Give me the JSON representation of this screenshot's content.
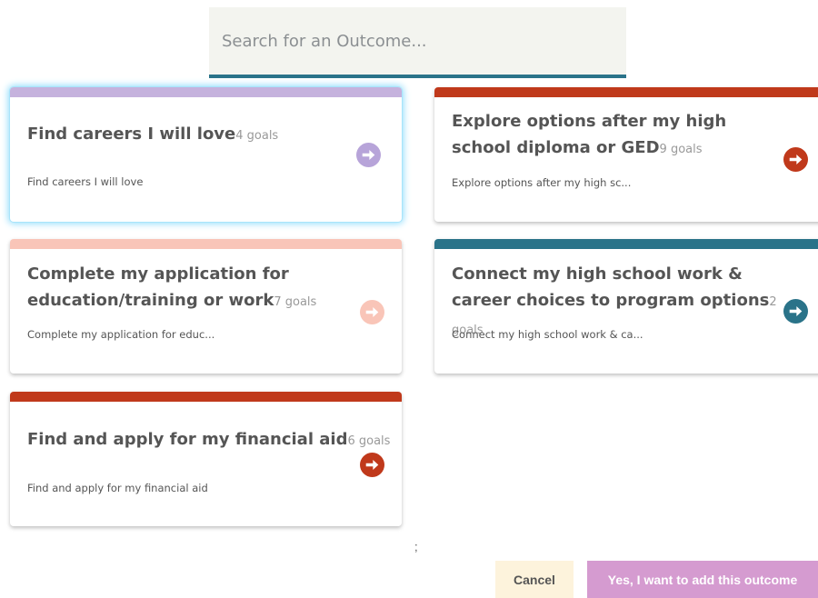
{
  "search": {
    "placeholder": "Search for an Outcome..."
  },
  "outcomes": [
    {
      "title": "Find careers I will love",
      "goals": "4 goals",
      "description": "Find careers I will love",
      "bar_color": "#c5b2dd",
      "arrow_color": "#b7a4d9",
      "selected": true,
      "arrow_icon": "arrow-right-circle-icon"
    },
    {
      "title": "Explore options after my high school diploma or GED",
      "goals": "9 goals",
      "description": "Explore options after my high sc...",
      "bar_color": "#c0391b",
      "arrow_color": "#c0391b",
      "selected": false,
      "arrow_icon": "arrow-right-circle-icon"
    },
    {
      "title": "Complete my application for education/training or work",
      "goals": "7 goals",
      "description": "Complete my application for educ...",
      "bar_color": "#f9c5b8",
      "arrow_color": "#f9c5b8",
      "selected": false,
      "arrow_icon": "arrow-right-circle-icon"
    },
    {
      "title": "Connect my high school work & career choices to program options",
      "goals": "2 goals",
      "description": "Connect my high school work & ca...",
      "bar_color": "#2a7389",
      "arrow_color": "#2a7389",
      "selected": false,
      "arrow_icon": "arrow-right-circle-icon"
    },
    {
      "title": "Find and apply for my financial aid",
      "goals": "6 goals",
      "description": "Find and apply for my financial aid",
      "bar_color": "#c0391b",
      "arrow_color": "#c0391b",
      "selected": false,
      "arrow_icon": "arrow-right-circle-icon"
    }
  ],
  "stray_text": ";",
  "buttons": {
    "cancel_label": "Cancel",
    "add_label": "Yes, I want to add this outcome",
    "cancel_bg": "#fdf3dc",
    "add_bg": "#d59bd0"
  }
}
